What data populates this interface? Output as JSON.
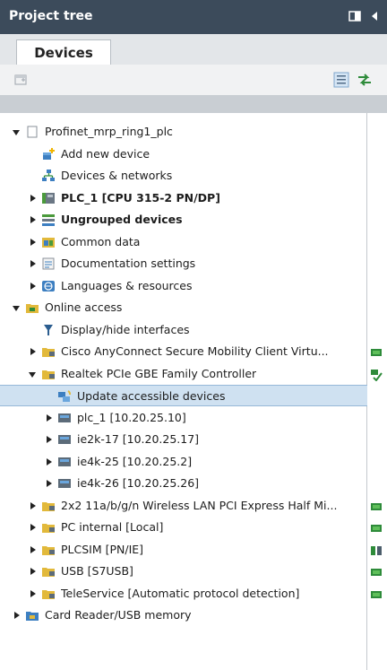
{
  "panel": {
    "title": "Project tree"
  },
  "tabs": [
    {
      "label": "Devices"
    }
  ],
  "tree": [
    {
      "id": "project",
      "label": "Profinet_mrp_ring1_plc",
      "bold": false,
      "indent": 0,
      "arrow": "expanded",
      "icon": "project-icon"
    },
    {
      "id": "add-new-device",
      "label": "Add new device",
      "bold": false,
      "indent": 1,
      "arrow": "none",
      "icon": "add-device-icon"
    },
    {
      "id": "devices-networks",
      "label": "Devices & networks",
      "bold": false,
      "indent": 1,
      "arrow": "none",
      "icon": "network-icon"
    },
    {
      "id": "plc1",
      "label": "PLC_1 [CPU 315-2 PN/DP]",
      "bold": true,
      "indent": 1,
      "arrow": "collapsed",
      "icon": "plc-icon"
    },
    {
      "id": "ungrouped",
      "label": "Ungrouped devices",
      "bold": true,
      "indent": 1,
      "arrow": "collapsed",
      "icon": "ungrouped-icon"
    },
    {
      "id": "common-data",
      "label": "Common data",
      "bold": false,
      "indent": 1,
      "arrow": "collapsed",
      "icon": "common-data-icon"
    },
    {
      "id": "doc-settings",
      "label": "Documentation settings",
      "bold": false,
      "indent": 1,
      "arrow": "collapsed",
      "icon": "documentation-icon"
    },
    {
      "id": "languages",
      "label": "Languages & resources",
      "bold": false,
      "indent": 1,
      "arrow": "collapsed",
      "icon": "languages-icon"
    },
    {
      "id": "online-access",
      "label": "Online access",
      "bold": false,
      "indent": 0,
      "arrow": "expanded",
      "icon": "online-access-icon"
    },
    {
      "id": "display-hide",
      "label": "Display/hide interfaces",
      "bold": false,
      "indent": 1,
      "arrow": "none",
      "icon": "filter-icon"
    },
    {
      "id": "cisco",
      "label": "Cisco AnyConnect Secure Mobility Client Virtu...",
      "bold": false,
      "indent": 1,
      "arrow": "collapsed",
      "icon": "network-adapter-icon",
      "status": "green"
    },
    {
      "id": "realtek",
      "label": "Realtek PCIe GBE Family Controller",
      "bold": false,
      "indent": 1,
      "arrow": "expanded",
      "icon": "network-adapter-icon",
      "status": "check"
    },
    {
      "id": "update-accessible",
      "label": "Update accessible devices",
      "bold": false,
      "indent": 2,
      "arrow": "none",
      "icon": "update-devices-icon",
      "selected": true
    },
    {
      "id": "plc-1-ip",
      "label": "plc_1 [10.20.25.10]",
      "bold": false,
      "indent": 2,
      "arrow": "collapsed",
      "icon": "device-icon"
    },
    {
      "id": "ie2k-17",
      "label": "ie2k-17 [10.20.25.17]",
      "bold": false,
      "indent": 2,
      "arrow": "collapsed",
      "icon": "device-icon"
    },
    {
      "id": "ie4k-25",
      "label": "ie4k-25 [10.20.25.2]",
      "bold": false,
      "indent": 2,
      "arrow": "collapsed",
      "icon": "device-icon"
    },
    {
      "id": "ie4k-26",
      "label": "ie4k-26 [10.20.25.26]",
      "bold": false,
      "indent": 2,
      "arrow": "collapsed",
      "icon": "device-icon"
    },
    {
      "id": "wireless",
      "label": "2x2 11a/b/g/n Wireless LAN PCI Express Half Mi...",
      "bold": false,
      "indent": 1,
      "arrow": "collapsed",
      "icon": "network-adapter-icon",
      "status": "green"
    },
    {
      "id": "pc-internal",
      "label": "PC internal [Local]",
      "bold": false,
      "indent": 1,
      "arrow": "collapsed",
      "icon": "network-adapter-icon",
      "status": "green"
    },
    {
      "id": "plcsim",
      "label": "PLCSIM [PN/IE]",
      "bold": false,
      "indent": 1,
      "arrow": "collapsed",
      "icon": "network-adapter-icon",
      "status": "mixed"
    },
    {
      "id": "usb",
      "label": "USB [S7USB]",
      "bold": false,
      "indent": 1,
      "arrow": "collapsed",
      "icon": "network-adapter-icon",
      "status": "green"
    },
    {
      "id": "teleservice",
      "label": "TeleService [Automatic protocol detection]",
      "bold": false,
      "indent": 1,
      "arrow": "collapsed",
      "icon": "network-adapter-icon",
      "status": "green"
    },
    {
      "id": "card-reader",
      "label": "Card Reader/USB memory",
      "bold": false,
      "indent": 0,
      "arrow": "collapsed",
      "icon": "card-reader-icon"
    }
  ]
}
